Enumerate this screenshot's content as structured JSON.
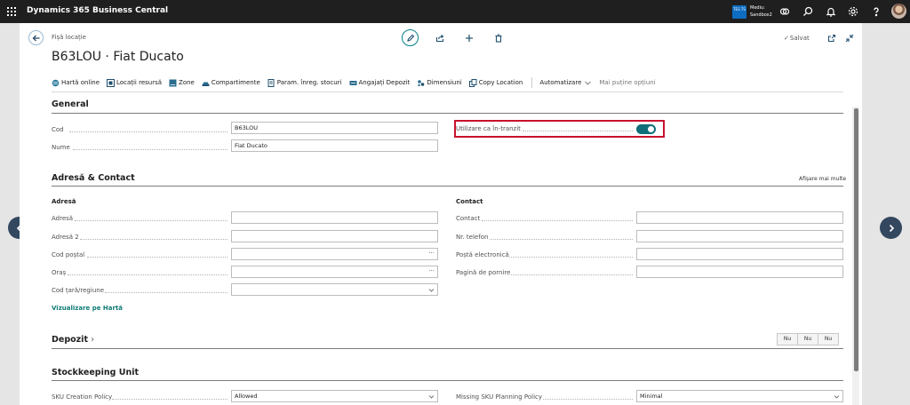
{
  "app": {
    "title": "Dynamics 365 Business Central"
  },
  "environment": {
    "badge": "TES TS",
    "label_line1": "Mediu:",
    "label_line2": "Sandbox2"
  },
  "page": {
    "caption": "Fișă locație",
    "title": "B63LOU · Fiat Ducato",
    "saved_label": "Salvat",
    "saved_check": "✓"
  },
  "actions": [
    {
      "label": "Hartă online",
      "icon": "map-icon"
    },
    {
      "label": "Locații resursă",
      "icon": "location-icon"
    },
    {
      "label": "Zone",
      "icon": "zone-icon"
    },
    {
      "label": "Compartimente",
      "icon": "bin-icon"
    },
    {
      "label": "Param. înreg. stocuri",
      "icon": "setup-icon"
    },
    {
      "label": "Angajați Depozit",
      "icon": "employees-icon"
    },
    {
      "label": "Dimensiuni",
      "icon": "dimensions-icon"
    },
    {
      "label": "Copy Location",
      "icon": "copy-icon"
    }
  ],
  "actions_more": {
    "automation": "Automatizare",
    "fewer": "Mai puține opțiuni"
  },
  "general": {
    "title": "General",
    "fields": [
      {
        "label": "Cod",
        "value": "B63LOU"
      },
      {
        "label": "Nume",
        "value": "Fiat Ducato"
      }
    ],
    "in_transit": {
      "label": "Utilizare ca în-tranzit",
      "value": true
    }
  },
  "address_contact": {
    "title": "Adresă & Contact",
    "show_more": "Afișare mai multe",
    "address_heading": "Adresă",
    "contact_heading": "Contact",
    "address_fields": [
      {
        "label": "Adresă",
        "value": ""
      },
      {
        "label": "Adresă 2",
        "value": ""
      },
      {
        "label": "Cod poștal",
        "value": "",
        "suffix": "···"
      },
      {
        "label": "Oraș",
        "value": "",
        "suffix": "···"
      },
      {
        "label": "Cod țară/regiune",
        "value": ""
      }
    ],
    "contact_fields": [
      {
        "label": "Contact",
        "value": ""
      },
      {
        "label": "Nr. telefon",
        "value": ""
      },
      {
        "label": "Poștă electronică",
        "value": ""
      },
      {
        "label": "Pagină de pornire",
        "value": ""
      }
    ],
    "map_link": "Vizualizare pe Hartă"
  },
  "depozit": {
    "title": "Depozit",
    "chevron": "›",
    "flags": [
      "Nu",
      "Nu",
      "Nu"
    ]
  },
  "sku": {
    "title": "Stockkeeping Unit",
    "fields": [
      {
        "label": "SKU Creation Policy",
        "value": "Allowed"
      },
      {
        "label": "Missing SKU Planning Policy",
        "value": "Minimal"
      }
    ]
  },
  "colors": {
    "accent": "#0f7b74",
    "highlight_border": "#c8102e",
    "topbar": "#1f1f1f",
    "nav_circle": "#33475f"
  }
}
